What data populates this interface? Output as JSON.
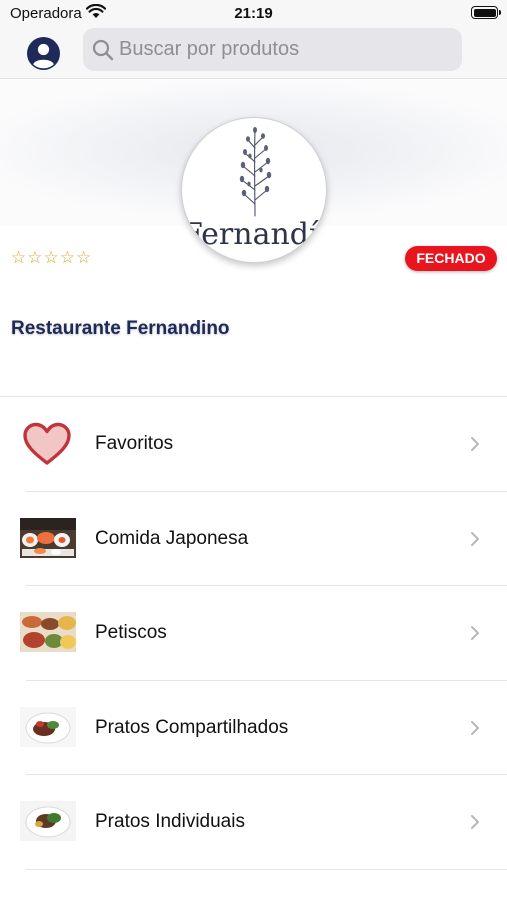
{
  "status_bar": {
    "carrier": "Operadora",
    "time": "21:19"
  },
  "search": {
    "placeholder": "Buscar por produtos",
    "value": ""
  },
  "restaurant": {
    "name": "Restaurante Fernandino",
    "logo_text": "Fernandíno",
    "rating_stars": "☆☆☆☆☆",
    "rating_value": 0,
    "status": "FECHADO"
  },
  "categories": [
    {
      "label": "Favoritos",
      "icon": "heart-icon"
    },
    {
      "label": "Comida Japonesa",
      "icon": "sushi-photo"
    },
    {
      "label": "Petiscos",
      "icon": "snacks-photo"
    },
    {
      "label": "Pratos Compartilhados",
      "icon": "shared-dish-photo"
    },
    {
      "label": "Pratos Individuais",
      "icon": "individual-dish-photo"
    }
  ],
  "colors": {
    "accent_navy": "#1d2a5a",
    "status_closed": "#e8151f",
    "star": "#e0a125",
    "heart": "#c0343b"
  }
}
